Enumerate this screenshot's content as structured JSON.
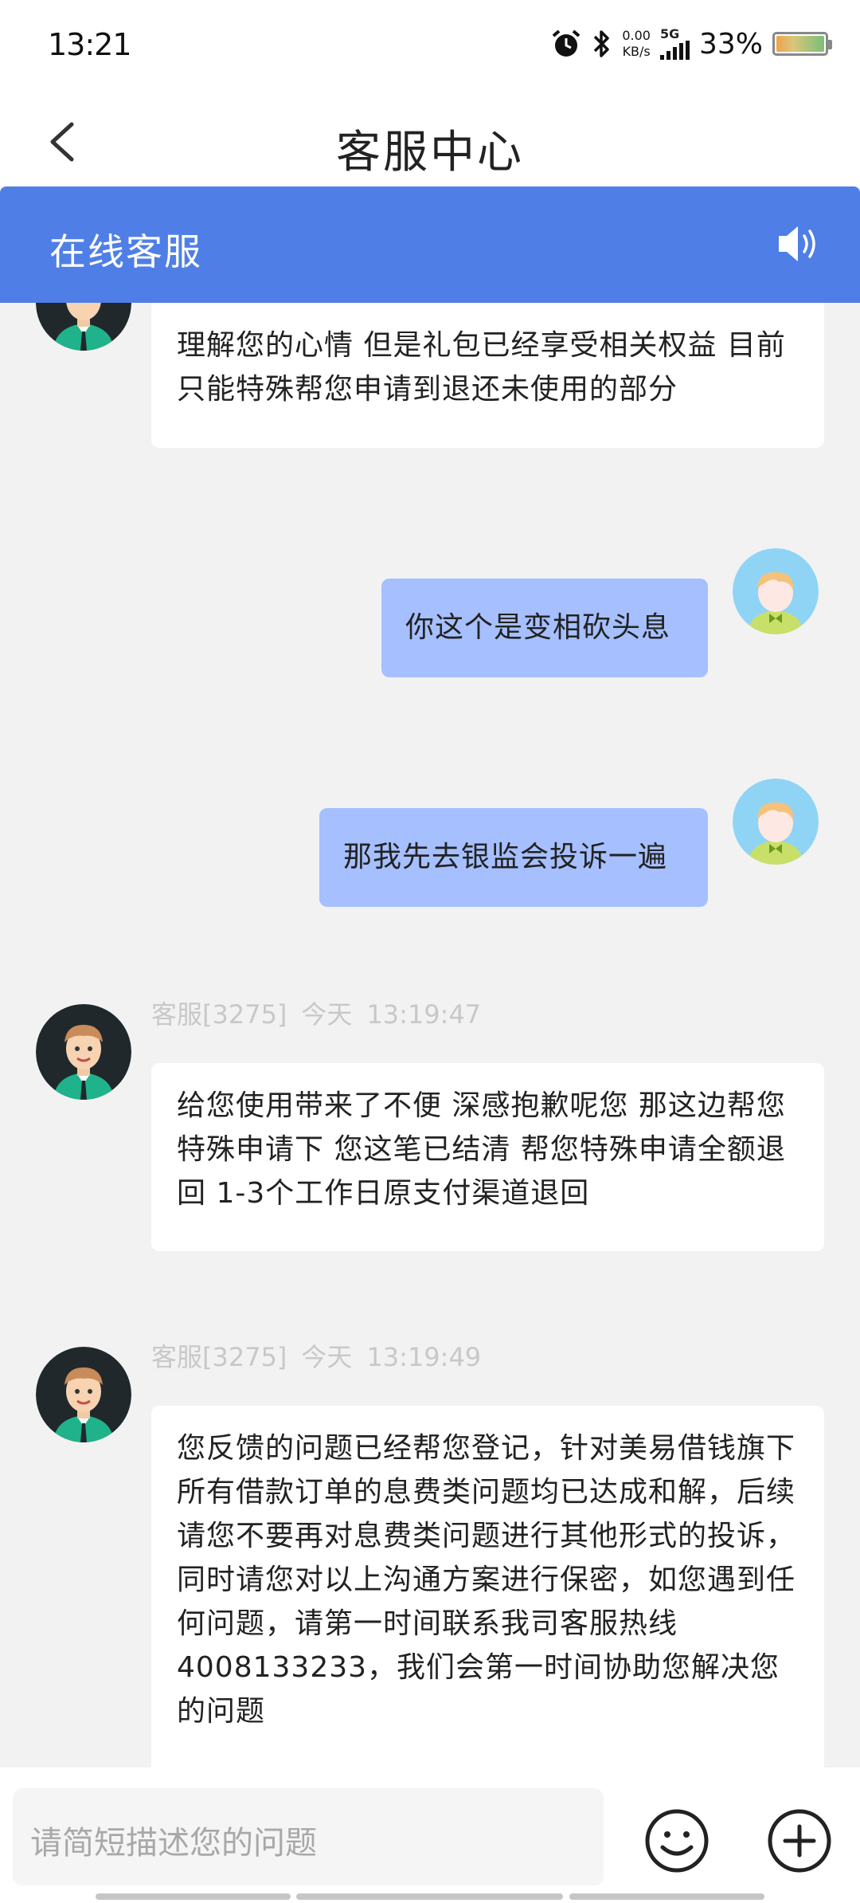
{
  "status": {
    "time": "13:21",
    "net_speed_value": "0.00",
    "net_speed_unit": "KB/s",
    "network": "5G",
    "battery": "33%"
  },
  "header": {
    "title": "客服中心"
  },
  "service_bar": {
    "label": "在线客服"
  },
  "messages": [
    {
      "text": "理解您的心情 但是礼包已经享受相关权益 目前只能特殊帮您申请到退还未使用的部分"
    },
    {
      "text": "你这个是变相砍头息"
    },
    {
      "text": "那我先去银监会投诉一遍"
    },
    {
      "sender": "客服[3275]",
      "day": "今天",
      "time": "13:19:47",
      "text": "给您使用带来了不便 深感抱歉呢您 那这边帮您特殊申请下 您这笔已结清 帮您特殊申请全额退回 1-3个工作日原支付渠道退回"
    },
    {
      "sender": "客服[3275]",
      "day": "今天",
      "time": "13:19:49",
      "text": "您反馈的问题已经帮您登记，针对美易借钱旗下所有借款订单的息费类问题均已达成和解，后续请您不要再对息费类问题进行其他形式的投诉，同时请您对以上沟通方案进行保密，如您遇到任何问题，请第一时间联系我司客服热线4008133233，我们会第一时间协助您解决您的问题"
    }
  ],
  "input": {
    "placeholder": "请简短描述您的问题"
  },
  "icons": {
    "back": "chevron-left-icon",
    "speaker": "speaker-icon",
    "emoji": "smiley-icon",
    "plus": "plus-circle-icon",
    "alarm": "alarm-icon",
    "bluetooth": "bluetooth-icon"
  },
  "colors": {
    "header_blue": "#4f7fe6",
    "user_bubble": "#a6bffe",
    "background": "#f2f2f2"
  }
}
